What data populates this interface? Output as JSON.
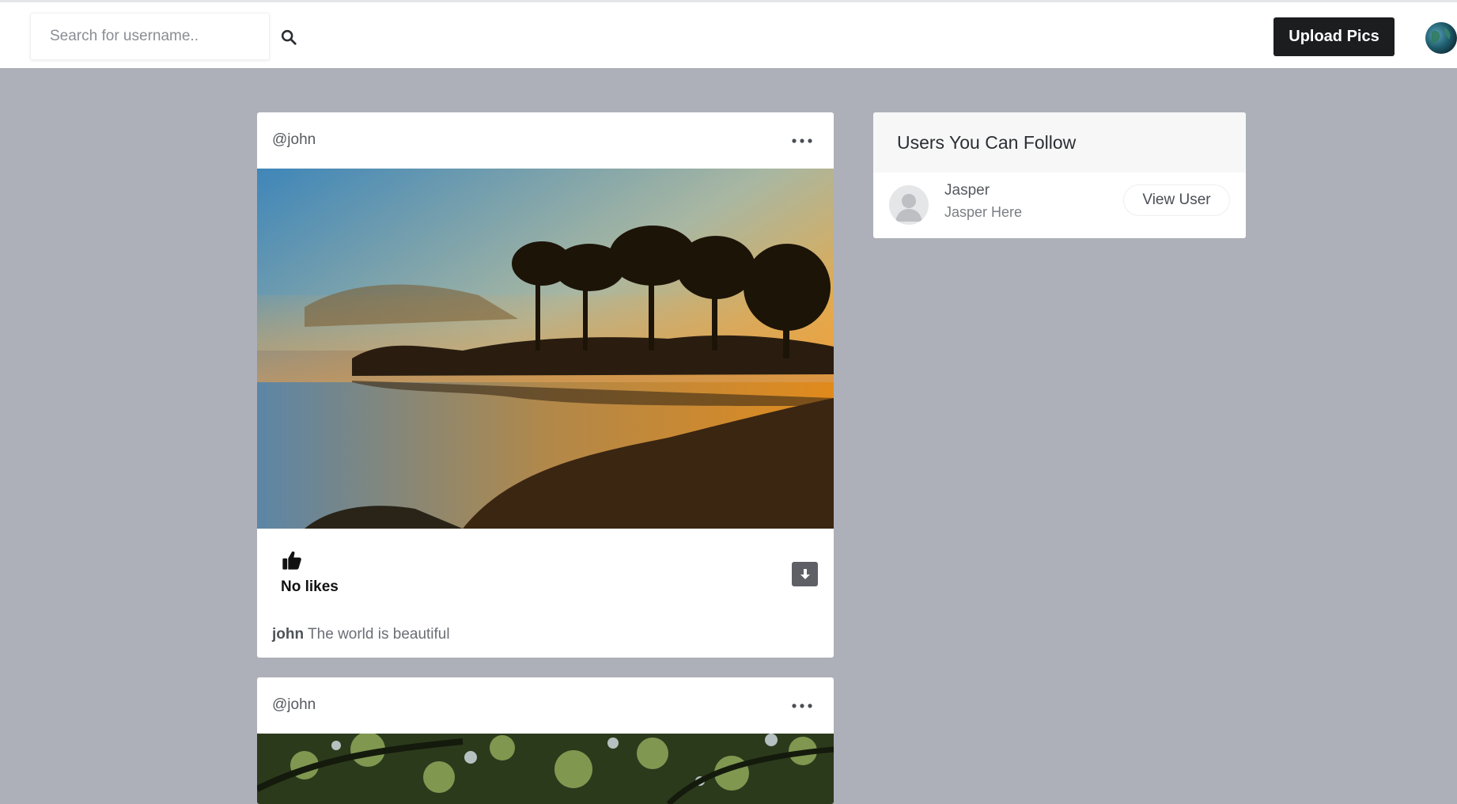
{
  "header": {
    "search_placeholder": "Search for username..",
    "upload_label": "Upload Pics"
  },
  "posts": [
    {
      "username": "@john",
      "likes_text": "No likes",
      "caption_user": "john",
      "caption_text": "The world is beautiful"
    },
    {
      "username": "@john"
    }
  ],
  "suggestions": {
    "title": "Users You Can Follow",
    "users": [
      {
        "name": "Jasper",
        "bio": "Jasper Here",
        "button_label": "View User"
      }
    ]
  },
  "icons": {
    "search": "search-icon",
    "menu": "more-horizontal-icon",
    "like": "thumbs-up-icon",
    "download": "download-icon",
    "avatar": "user-avatar-icon"
  },
  "colors": {
    "page_bg": "#adb0b8",
    "button_dark": "#1c1d1f",
    "card_bg": "#ffffff"
  }
}
